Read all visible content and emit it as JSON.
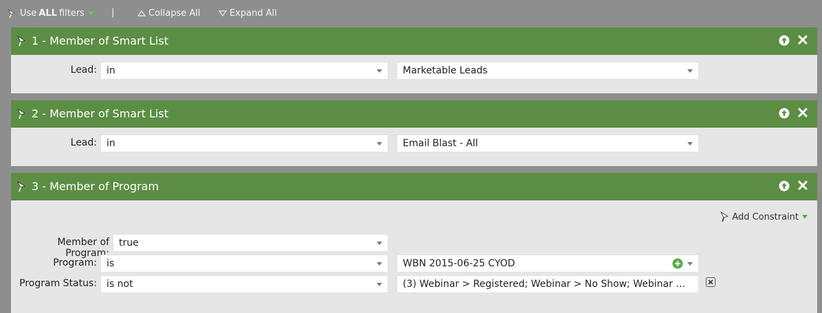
{
  "toolbar": {
    "use_prefix": "Use",
    "use_bold": "ALL",
    "use_suffix": "filters",
    "separator": "|",
    "collapse_label": "Collapse All",
    "expand_label": "Expand All"
  },
  "filters": [
    {
      "title": "1 - Member of Smart List",
      "label": "Lead:",
      "operator": "in",
      "value": "Marketable Leads"
    },
    {
      "title": "2 - Member of Smart List",
      "label": "Lead:",
      "operator": "in",
      "value": "Email Blast - All"
    },
    {
      "title": "3 - Member of Program",
      "add_constraint_label": "Add Constraint",
      "rows": [
        {
          "label": "Member of Program:",
          "operator": "true"
        },
        {
          "label": "Program:",
          "operator": "is",
          "value": "WBN 2015-06-25 CYOD"
        },
        {
          "label": "Program Status:",
          "operator": "is not",
          "value": "(3) Webinar > Registered; Webinar > No Show; Webinar > Atten..."
        }
      ]
    }
  ],
  "colors": {
    "background": "#8e8e8e",
    "header_green": "#5b8e44",
    "panel_body": "#e6e6e6",
    "accent_green": "#4caf3c"
  }
}
